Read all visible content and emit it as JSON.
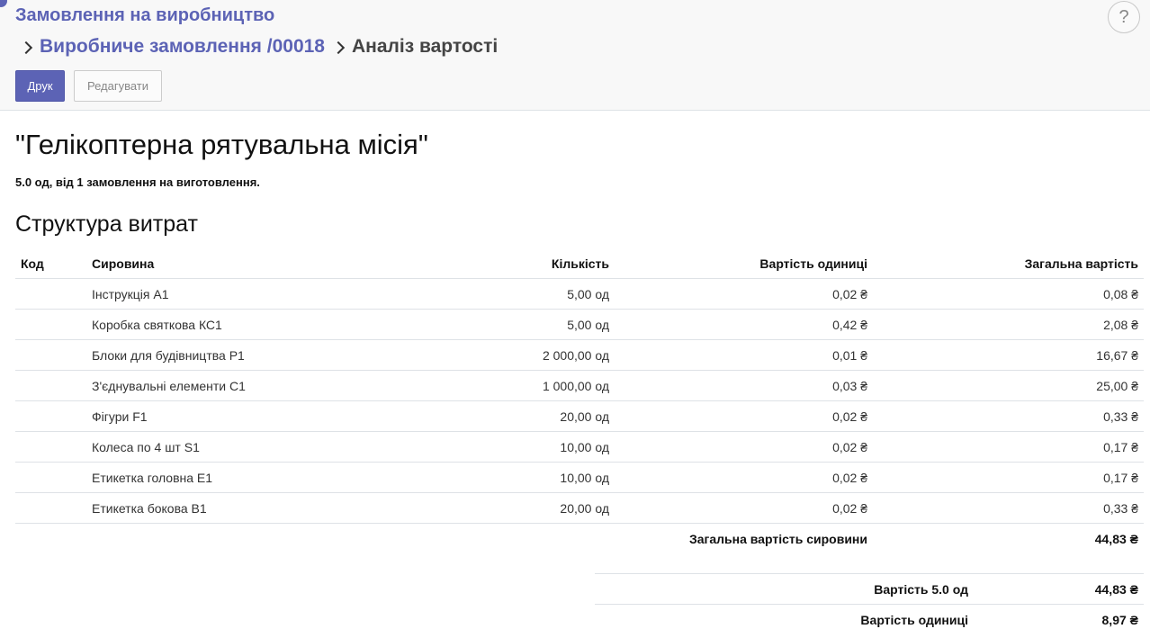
{
  "breadcrumb": {
    "root": "Замовлення на виробництво",
    "order": "Виробниче замовлення /00018",
    "current": "Аналіз вартості"
  },
  "help_label": "?",
  "buttons": {
    "print": "Друк",
    "edit": "Редагувати"
  },
  "report": {
    "title": "\"Гелікоптерна рятувальна місія\"",
    "subtitle": "5.0 од, від 1 замовлення на виготовлення.",
    "section_title": "Структура витрат",
    "columns": [
      "Код",
      "Сировина",
      "Кількість",
      "Вартість одиниці",
      "Загальна вартість"
    ],
    "rows": [
      {
        "code": "",
        "material": "Інструкція A1",
        "qty": "5,00 од",
        "unit_cost": "0,02 ₴",
        "total": "0,08 ₴"
      },
      {
        "code": "",
        "material": "Коробка святкова КС1",
        "qty": "5,00 од",
        "unit_cost": "0,42 ₴",
        "total": "2,08 ₴"
      },
      {
        "code": "",
        "material": "Блоки для будівництва P1",
        "qty": "2 000,00 од",
        "unit_cost": "0,01 ₴",
        "total": "16,67 ₴"
      },
      {
        "code": "",
        "material": "З'єднувальні елементи C1",
        "qty": "1 000,00 од",
        "unit_cost": "0,03 ₴",
        "total": "25,00 ₴"
      },
      {
        "code": "",
        "material": "Фігури F1",
        "qty": "20,00 од",
        "unit_cost": "0,02 ₴",
        "total": "0,33 ₴"
      },
      {
        "code": "",
        "material": "Колеса по 4 шт S1",
        "qty": "10,00 од",
        "unit_cost": "0,02 ₴",
        "total": "0,17 ₴"
      },
      {
        "code": "",
        "material": "Етикетка головна E1",
        "qty": "10,00 од",
        "unit_cost": "0,02 ₴",
        "total": "0,17 ₴"
      },
      {
        "code": "",
        "material": "Етикетка бокова B1",
        "qty": "20,00 од",
        "unit_cost": "0,02 ₴",
        "total": "0,33 ₴"
      }
    ],
    "raw_total_label": "Загальна вартість сировини",
    "raw_total_value": "44,83 ₴",
    "summary": [
      {
        "label": "Вартість 5.0 од",
        "value": "44,83 ₴"
      },
      {
        "label": "Вартість одиниці",
        "value": "8,97 ₴"
      }
    ]
  },
  "colors": {
    "accent": "#5c63b5",
    "panel_bg": "#f8f8f8",
    "divider": "#dee2e6"
  }
}
